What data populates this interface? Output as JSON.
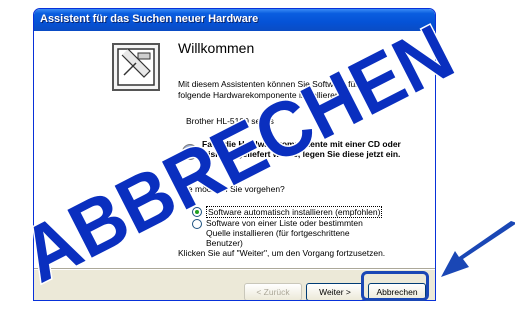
{
  "window": {
    "title": "Assistent für das Suchen neuer Hardware"
  },
  "wizard": {
    "heading": "Willkommen",
    "intro": "Mit diesem Assistenten können Sie Software für die folgende Hardwarekomponente installieren:",
    "device": "Brother  HL-5100 series",
    "cd_text": "Falls die Hardwarekomponente mit einer CD oder Diskette geliefert wurde, legen Sie diese jetzt ein.",
    "question": "Wie möchten Sie vorgehen?",
    "options": [
      {
        "label": "Software automatisch installieren (empfohlen)",
        "selected": true
      },
      {
        "label": "Software von einer Liste oder bestimmten Quelle installieren (für fortgeschrittene Benutzer)",
        "selected": false
      }
    ],
    "footer": "Klicken Sie auf \"Weiter\", um den Vorgang fortzusetzen."
  },
  "buttons": {
    "back": "< Zurück",
    "next": "Weiter >",
    "cancel": "Abbrechen"
  },
  "watermark": {
    "text": "ABBRECHEN",
    "color": "#0a2fbf"
  },
  "accent": {
    "title_bar": "#0a5ee0",
    "callout": "#1a47b5"
  }
}
